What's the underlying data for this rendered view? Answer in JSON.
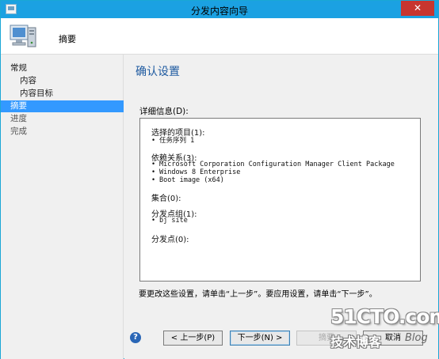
{
  "window": {
    "title": "分发内容向导",
    "close_label": "✕"
  },
  "header": {
    "title": "摘要"
  },
  "nav": {
    "items": [
      {
        "label": "常规"
      },
      {
        "label": "内容"
      },
      {
        "label": "内容目标"
      },
      {
        "label": "摘要"
      },
      {
        "label": "进度"
      },
      {
        "label": "完成"
      }
    ]
  },
  "main": {
    "page_title": "确认设置",
    "details_label": "详细信息(D):",
    "details": {
      "selected_heading": "选择的项目(1):",
      "selected_items": [
        "任务序列 1"
      ],
      "dependencies_heading": "依赖关系(3):",
      "dependencies_items": [
        "Microsoft Corporation Configuration Manager Client Package",
        "Windows 8 Enterprise",
        "Boot image (x64)"
      ],
      "collections_heading": "集合(0):",
      "dp_groups_heading": "分发点组(1):",
      "dp_groups_items": [
        "bj site"
      ],
      "dps_heading": "分发点(0):"
    },
    "hint": "要更改这些设置，请单击“上一步”。要应用设置，请单击“下一步”。"
  },
  "footer": {
    "help_icon": "?",
    "prev_label": "< 上一步(P)",
    "next_label": "下一步(N) >",
    "summary_label": "摘要",
    "cancel_label": "取消"
  },
  "watermark": {
    "main": "51CTO.com",
    "sub": "技术博客",
    "blog": "Blog"
  },
  "colors": {
    "titlebar": "#1ba1e2",
    "nav_active": "#3399ff",
    "page_title": "#1e5aa0",
    "close_button": "#c7352f"
  }
}
